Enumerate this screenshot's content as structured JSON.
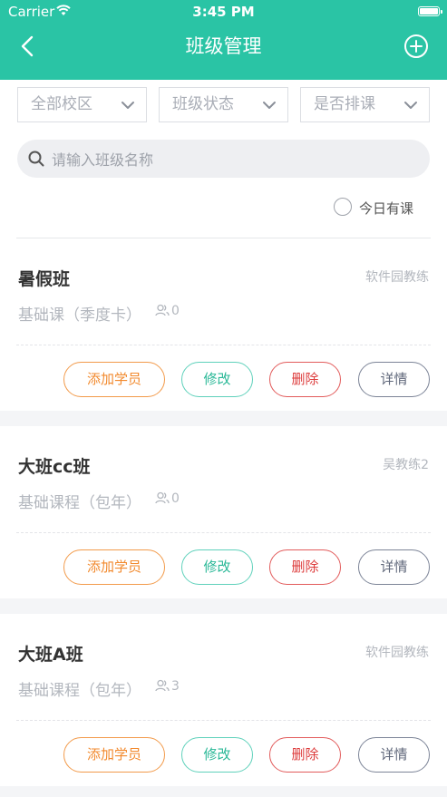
{
  "status_bar": {
    "carrier": "Carrier",
    "time": "3:45 PM"
  },
  "header": {
    "title": "班级管理",
    "back_icon": "chevron-left-icon",
    "add_icon": "plus-circle-icon"
  },
  "filters": {
    "dropdowns": [
      {
        "label": "全部校区"
      },
      {
        "label": "班级状态"
      },
      {
        "label": "是否排课"
      }
    ],
    "search_placeholder": "请输入班级名称",
    "today_label": "今日有课"
  },
  "classes": [
    {
      "name": "暑假班",
      "coach": "软件园教练",
      "course": "基础课（季度卡）",
      "students": "0"
    },
    {
      "name": "大班cc班",
      "coach": "吴教练2",
      "course": "基础课程（包年）",
      "students": "0"
    },
    {
      "name": "大班A班",
      "coach": "软件园教练",
      "course": "基础课程（包年）",
      "students": "3"
    }
  ],
  "actions": {
    "add_student": "添加学员",
    "edit": "修改",
    "delete": "删除",
    "detail": "详情"
  },
  "colors": {
    "primary": "#2ac4a5",
    "orange": "#f28a2e",
    "red": "#dd3b3b"
  }
}
